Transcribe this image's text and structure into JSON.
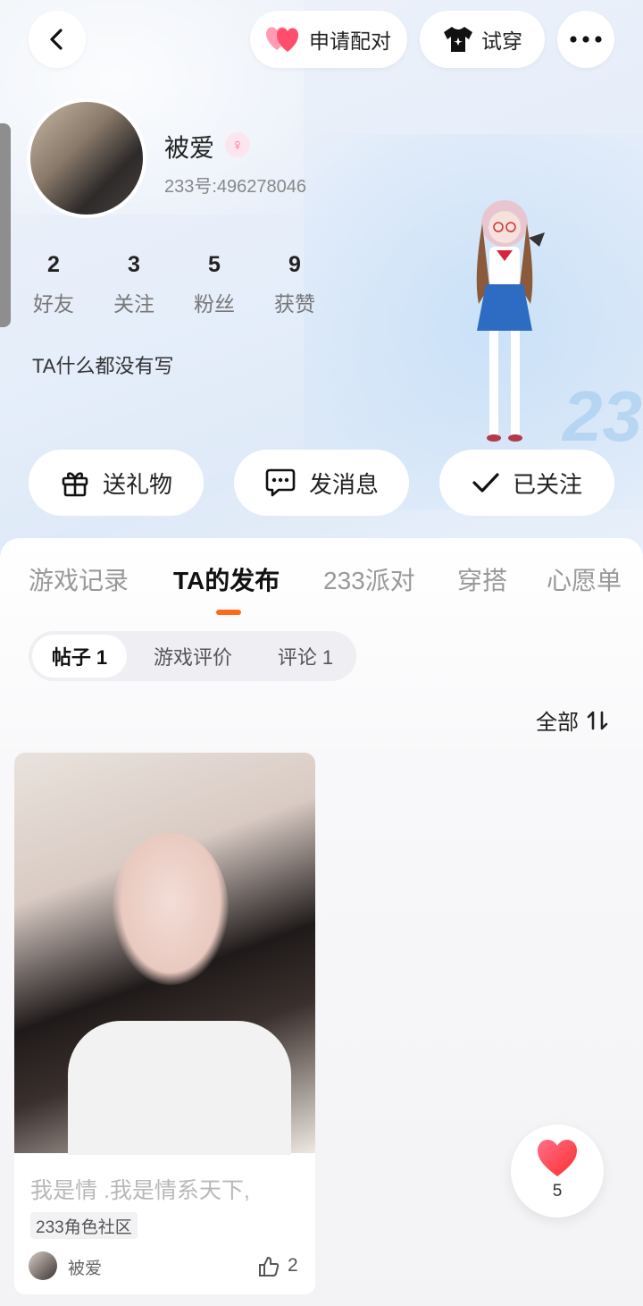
{
  "header": {
    "match_label": "申请配对",
    "try_on_label": "试穿"
  },
  "profile": {
    "nickname": "被爱",
    "gender_symbol": "♀",
    "uid": "233号:496278046",
    "stats": [
      {
        "num": "2",
        "label": "好友"
      },
      {
        "num": "3",
        "label": "关注"
      },
      {
        "num": "5",
        "label": "粉丝"
      },
      {
        "num": "9",
        "label": "获赞"
      }
    ],
    "bio": "TA什么都没有写"
  },
  "actions": {
    "gift_label": "送礼物",
    "message_label": "发消息",
    "follow_label": "已关注"
  },
  "tabs": [
    "游戏记录",
    "TA的发布",
    "233派对",
    "穿搭",
    "心愿单"
  ],
  "active_tab": "TA的发布",
  "subtabs": [
    "帖子 1",
    "游戏评价",
    "评论 1"
  ],
  "sort_label": "全部",
  "posts": [
    {
      "title": "我是情 .我是情系天下,",
      "tag": "233角色社区",
      "author": "被爱",
      "likes": "2"
    }
  ],
  "floating": {
    "likes": "5"
  },
  "colors": {
    "accent_orange": "#ff6a1a",
    "heart_red": "#ff3b3b",
    "heart_pink": "#ff6f8a"
  },
  "decor_text": "233"
}
